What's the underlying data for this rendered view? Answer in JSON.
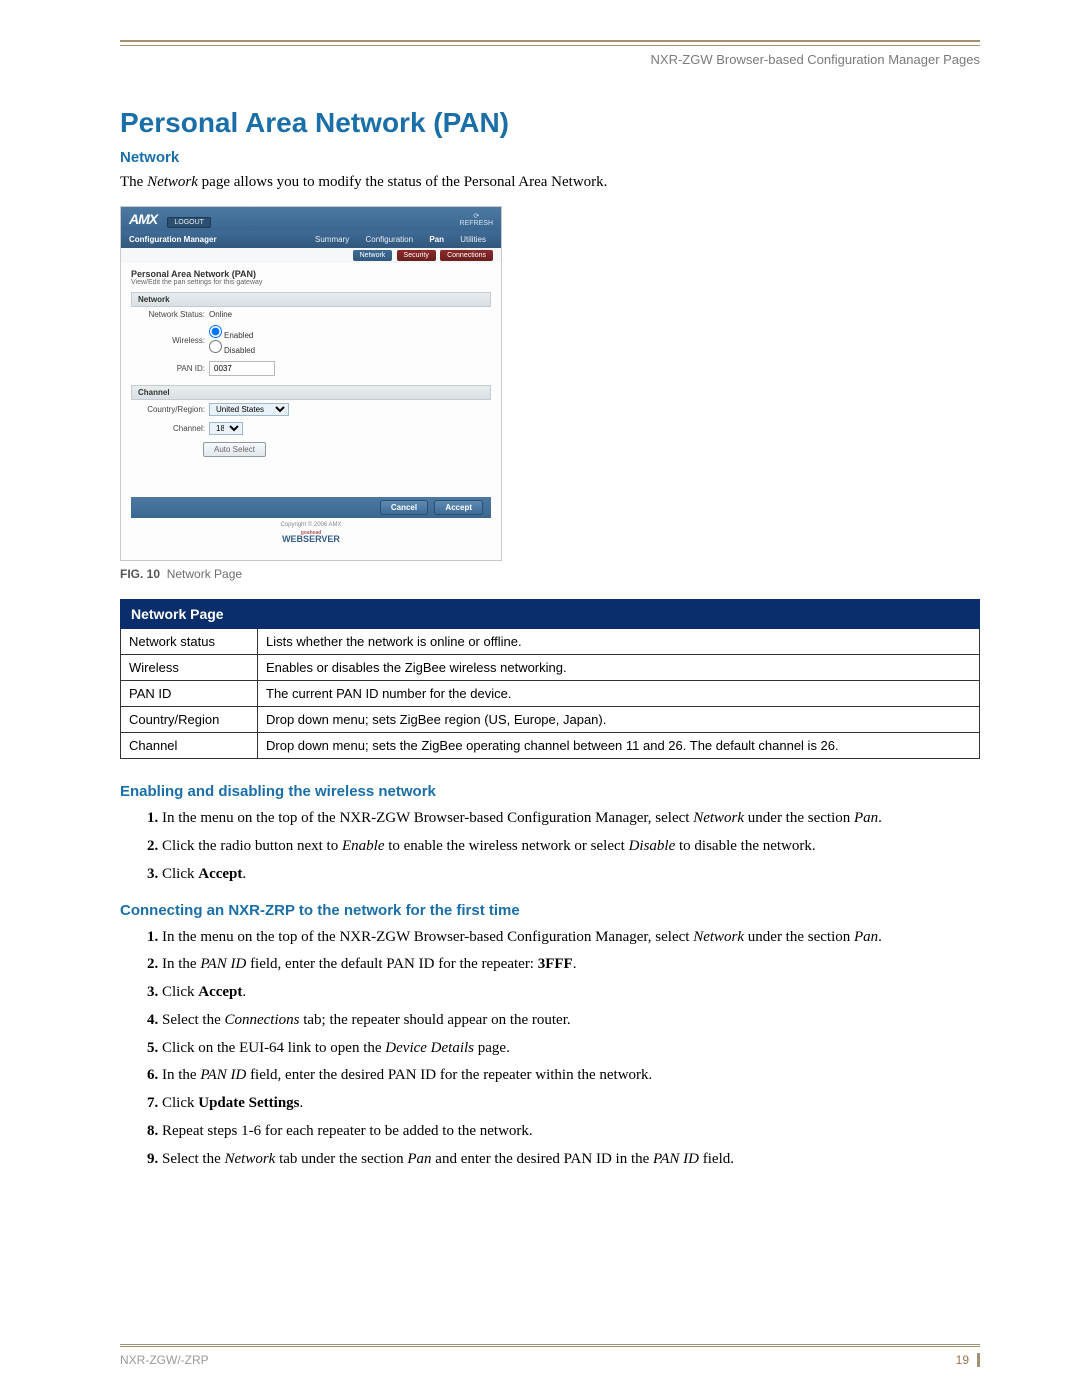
{
  "header": {
    "right": "NXR-ZGW Browser-based Configuration Manager Pages"
  },
  "title": "Personal Area Network (PAN)",
  "network": {
    "heading": "Network",
    "intro_pre": "The ",
    "intro_em": "Network",
    "intro_post": " page allows you to modify the status of the Personal Area Network."
  },
  "shot": {
    "logo": "AMX",
    "logout": "LOGOUT",
    "refresh": "REFRESH",
    "confmgr": "Configuration Manager",
    "tabs": [
      "Summary",
      "Configuration",
      "Pan",
      "Utilities"
    ],
    "subtabs": [
      "Network",
      "Security",
      "Connections"
    ],
    "pan_title": "Personal Area Network (PAN)",
    "pan_sub": "View/Edit the pan settings for this gateway",
    "sec_network": "Network",
    "lbl_status": "Network Status:",
    "val_status": "Online",
    "lbl_wireless": "Wireless:",
    "opt_enabled": "Enabled",
    "opt_disabled": "Disabled",
    "lbl_panid": "PAN ID:",
    "val_panid": "0037",
    "sec_channel": "Channel",
    "lbl_country": "Country/Region:",
    "val_country": "United States",
    "lbl_channel": "Channel:",
    "val_channel": "18",
    "btn_autoselect": "Auto Select",
    "btn_cancel": "Cancel",
    "btn_accept": "Accept",
    "copyright": "Copyright © 2006 AMX",
    "webserver_pre": "goahead",
    "webserver": "WEBSERVER"
  },
  "fig": {
    "label": "FIG. 10",
    "text": "Network Page"
  },
  "table": {
    "header": "Network Page",
    "rows": [
      {
        "k": "Network status",
        "v": "Lists whether the network is online or offline."
      },
      {
        "k": "Wireless",
        "v": "Enables or disables the ZigBee wireless networking."
      },
      {
        "k": "PAN ID",
        "v": "The current PAN ID number for the device."
      },
      {
        "k": "Country/Region",
        "v": "Drop down menu; sets ZigBee region (US, Europe, Japan)."
      },
      {
        "k": "Channel",
        "v": "Drop down menu; sets the ZigBee operating channel between 11 and 26. The default channel is 26."
      }
    ]
  },
  "sub1": {
    "heading": "Enabling and disabling the wireless network",
    "s1a": "In the menu on the top of the NXR-ZGW Browser-based Configuration Manager, select ",
    "s1b": "Network",
    "s1c": " under the section ",
    "s1d": "Pan",
    "s1e": ".",
    "s2a": "Click the radio button next to ",
    "s2b": "Enable",
    "s2c": " to enable the wireless network or select ",
    "s2d": "Disable",
    "s2e": " to disable the network.",
    "s3a": "Click ",
    "s3b": "Accept",
    "s3c": "."
  },
  "sub2": {
    "heading": "Connecting an NXR-ZRP to the network for the first time",
    "s1a": "In the menu on the top of the NXR-ZGW Browser-based Configuration Manager, select ",
    "s1b": "Network",
    "s1c": " under the section ",
    "s1d": "Pan",
    "s1e": ".",
    "s2a": "In the ",
    "s2b": "PAN ID",
    "s2c": " field, enter the default PAN ID for the repeater: ",
    "s2d": "3FFF",
    "s2e": ".",
    "s3a": "Click ",
    "s3b": "Accept",
    "s3c": ".",
    "s4a": "Select the ",
    "s4b": "Connections",
    "s4c": " tab; the repeater should appear on the router.",
    "s5a": "Click on the EUI-64 link to open the ",
    "s5b": "Device Details",
    "s5c": " page.",
    "s6a": "In the ",
    "s6b": "PAN ID",
    "s6c": " field, enter the desired PAN ID for the repeater within the network.",
    "s7a": "Click ",
    "s7b": "Update Settings",
    "s7c": ".",
    "s8": "Repeat steps 1-6 for each repeater to be added to the network.",
    "s9a": "Select the ",
    "s9b": "Network",
    "s9c": " tab under the section ",
    "s9d": "Pan",
    "s9e": " and enter the desired PAN ID in the ",
    "s9f": "PAN ID",
    "s9g": " field."
  },
  "footer": {
    "left": "NXR-ZGW/-ZRP",
    "page": "19"
  }
}
